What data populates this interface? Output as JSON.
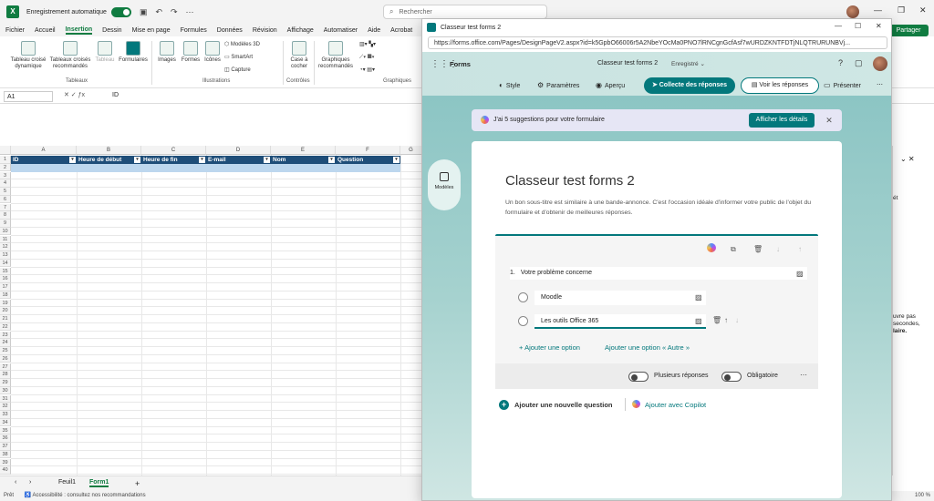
{
  "excel": {
    "autosave_label": "Enregistrement automatique",
    "search_placeholder": "Rechercher",
    "share_label": "Partager",
    "menu": [
      "Fichier",
      "Accueil",
      "Insertion",
      "Dessin",
      "Mise en page",
      "Formules",
      "Données",
      "Révision",
      "Affichage",
      "Automatiser",
      "Aide",
      "Acrobat"
    ],
    "active_menu": "Insertion",
    "ribbon": {
      "pivot": "Tableau croisé dynamique",
      "recommended_pivots": "Tableaux croisés recommandés",
      "table": "Tableau",
      "forms": "Formulaires",
      "images": "Images",
      "shapes": "Formes",
      "icons": "Icônes",
      "models3d": "Modèles 3D",
      "smartart": "SmartArt",
      "capture": "Capture",
      "checkbox": "Case à cocher",
      "recommended_charts": "Graphiques recommandés",
      "group_tables": "Tableaux",
      "group_illustrations": "Illustrations",
      "group_controls": "Contrôles",
      "group_charts": "Graphiques"
    },
    "namebox": "A1",
    "formula": "ID",
    "columns": [
      "A",
      "B",
      "C",
      "D",
      "E",
      "F",
      "G"
    ],
    "table_headers": [
      "ID",
      "Heure de début",
      "Heure de fin",
      "E-mail",
      "Nom",
      "Question"
    ],
    "rows": [
      "1",
      "2",
      "3",
      "4",
      "5",
      "6",
      "7",
      "8",
      "9",
      "10",
      "11",
      "12",
      "13",
      "14",
      "15",
      "16",
      "17",
      "18",
      "19",
      "20",
      "21",
      "22",
      "23",
      "24",
      "25",
      "26",
      "27",
      "28",
      "29",
      "30",
      "31",
      "32",
      "33",
      "34",
      "35",
      "36",
      "37",
      "38",
      "39",
      "40"
    ],
    "sheets": [
      "Feuil1",
      "Form1"
    ],
    "active_sheet": "Form1",
    "status_ready": "Prêt",
    "status_accessibility": "Accessibilité : consultez nos recommandations",
    "zoom": "100 %",
    "right_pane_fragments": [
      "ét",
      "uvre pas",
      "secondes,",
      "laire."
    ]
  },
  "browser": {
    "window_title": "Classeur test forms 2",
    "url": "https://forms.office.com/Pages/DesignPageV2.aspx?id=k5GpbO66006r5A2NbeYOcMa0PNO7lRNCgnGcfAsf7wURDZKNTFDTjNLQTRURUNBVj..."
  },
  "forms": {
    "app_name": "Forms",
    "form_title": "Classeur test forms 2",
    "saved_status": "Enregistré",
    "tools": {
      "style": "Style",
      "settings": "Paramètres",
      "preview": "Aperçu",
      "collect": "Collecte des réponses",
      "view_responses": "Voir les réponses",
      "present": "Présenter"
    },
    "suggestion": {
      "text": "J'ai 5 suggestions pour votre formulaire",
      "button": "Afficher les détails"
    },
    "templates_label": "Modèles",
    "title": "Classeur test forms 2",
    "subtitle": "Un bon sous-titre est similaire à une bande-annonce. C'est l'occasion idéale d'informer votre public de l'objet du formulaire et d'obtenir de meilleures réponses.",
    "question": {
      "number": "1.",
      "text": "Votre problème concerne",
      "options": [
        "Moodle",
        "Les outils Office 365"
      ],
      "add_option": "Ajouter une option",
      "add_other": "Ajouter une option « Autre »",
      "multiple": "Plusieurs réponses",
      "required": "Obligatoire"
    },
    "add_question": "Ajouter une nouvelle question",
    "add_copilot": "Ajouter avec Copilot"
  },
  "colors": {
    "excel_green": "#107c41",
    "forms_teal": "#03787c",
    "table_header": "#1f4e79",
    "table_row": "#bdd7ee"
  },
  "icons": [
    "excel-logo-icon",
    "search-icon",
    "undo-icon",
    "redo-icon",
    "waffle-icon",
    "help-icon",
    "feedback-icon",
    "copilot-icon",
    "copy-icon",
    "trash-icon",
    "arrow-up-icon",
    "arrow-down-icon",
    "image-icon",
    "more-icon",
    "close-icon"
  ]
}
